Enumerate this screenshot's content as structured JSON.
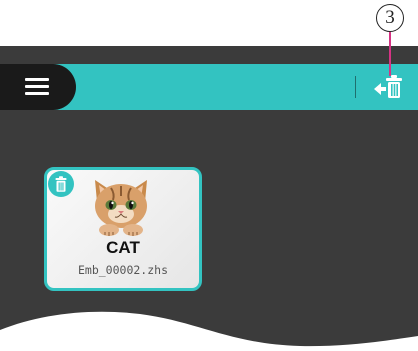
{
  "callout": {
    "number": "3"
  },
  "toolbar": {
    "menu_icon": "hamburger-menu-icon",
    "back_delete_icon": "back-arrow-trash-icon"
  },
  "file_card": {
    "title": "CAT",
    "filename": "Emb_00002.zhs",
    "delete_icon": "trash-icon",
    "thumbnail": "cat-embroidery-thumbnail"
  },
  "colors": {
    "accent": "#33c3c1",
    "screen_bg": "#3b3b3b",
    "menu_bg": "#1a1a1a",
    "callout_line": "#d63384"
  }
}
